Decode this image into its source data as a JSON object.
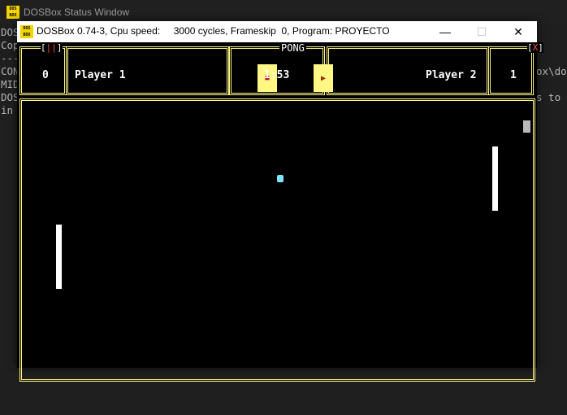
{
  "status_window": {
    "title": "DOSBox Status Window",
    "logo_text": "DOS BOX",
    "console_lines": [
      "DOS",
      "Cop",
      "---",
      "CON",
      "MID",
      "DOS",
      "in"
    ],
    "console_right_lines": [
      "ox\\do",
      "s to"
    ]
  },
  "dosbox_window": {
    "logo_text": "DOS BOX",
    "title": "DOSBox 0.74-3, Cpu speed:     3000 cycles, Frameskip  0, Program: PROYECTO",
    "minimize_glyph": "—",
    "maximize_glyph": "☐",
    "close_glyph": "✕"
  },
  "game": {
    "title": "PONG",
    "left_indicator_open": "[",
    "left_indicator_mid": "||",
    "left_indicator_close": "]",
    "close_indicator_open": "[",
    "close_indicator_mid": "X",
    "close_indicator_close": "]",
    "player1": {
      "name": "Player 1",
      "score": "0"
    },
    "player2": {
      "name": "Player 2",
      "score": "1"
    },
    "timer": "1:53",
    "pause_icon": "■",
    "play_icon": "▶",
    "colors": {
      "panel_border": "#fff784",
      "ball": "#7fe6ff",
      "paddle": "#ffffff",
      "accent_red": "#ff4a4a"
    }
  }
}
